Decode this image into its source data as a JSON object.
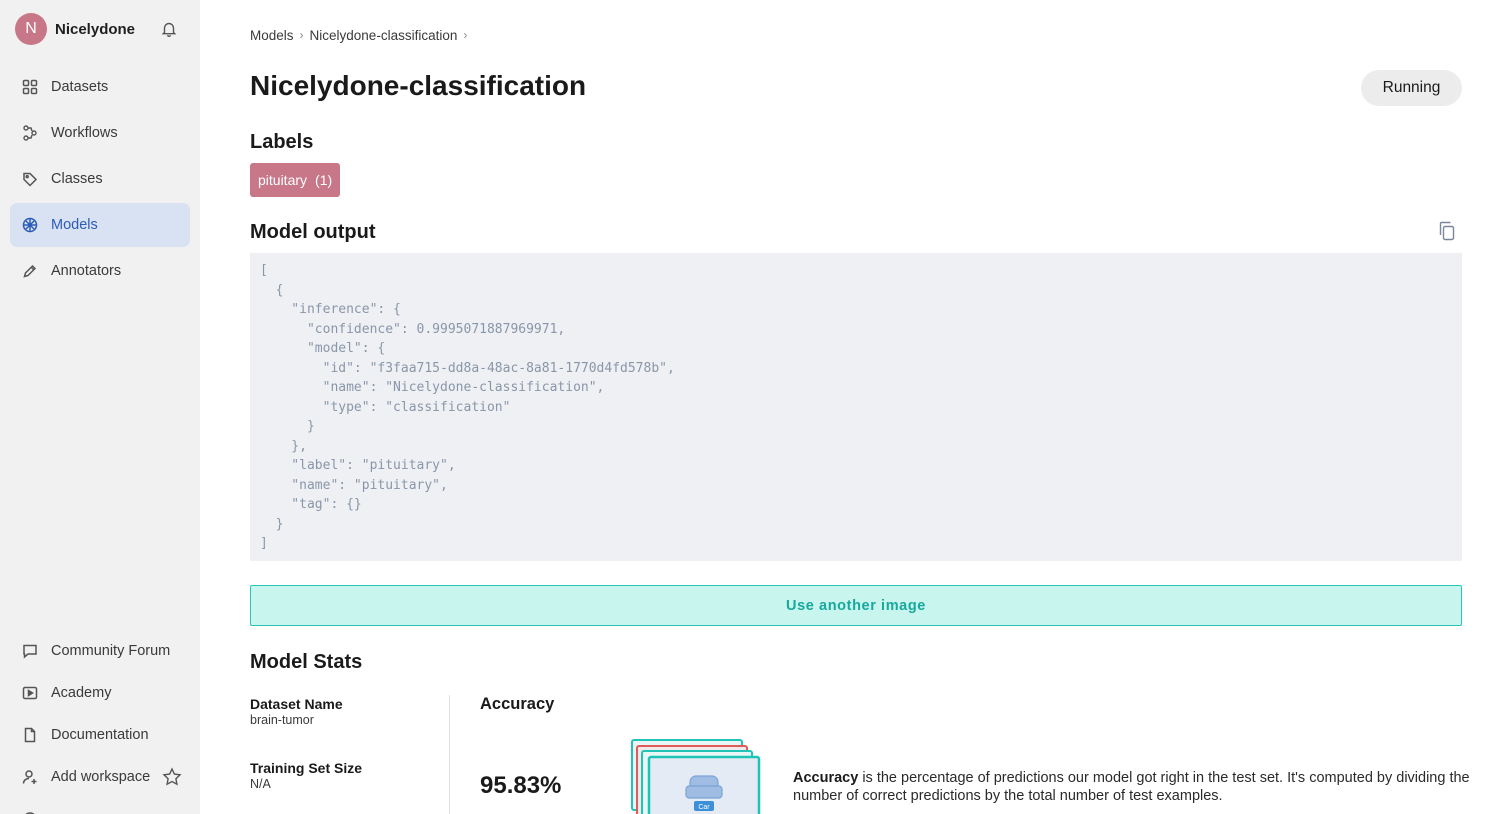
{
  "workspace": {
    "initial": "N",
    "name": "Nicelydone"
  },
  "sidebar": {
    "items": [
      {
        "label": "Datasets"
      },
      {
        "label": "Workflows"
      },
      {
        "label": "Classes"
      },
      {
        "label": "Models"
      },
      {
        "label": "Annotators"
      }
    ],
    "bottom": [
      {
        "label": "Community Forum"
      },
      {
        "label": "Academy"
      },
      {
        "label": "Documentation"
      },
      {
        "label": "Add workspace"
      }
    ]
  },
  "breadcrumb": {
    "root": "Models",
    "current": "Nicelydone-classification"
  },
  "page": {
    "title": "Nicelydone-classification",
    "status": "Running"
  },
  "labels": {
    "heading": "Labels",
    "chip": "pituitary",
    "count": "(1)"
  },
  "output": {
    "heading": "Model output",
    "code": "[\n  {\n    \"inference\": {\n      \"confidence\": 0.9995071887969971,\n      \"model\": {\n        \"id\": \"f3faa715-dd8a-48ac-8a81-1770d4fd578b\",\n        \"name\": \"Nicelydone-classification\",\n        \"type\": \"classification\"\n      }\n    },\n    \"label\": \"pituitary\",\n    \"name\": \"pituitary\",\n    \"tag\": {}\n  }\n]",
    "button": "Use another image"
  },
  "stats": {
    "heading": "Model Stats",
    "dataset_label": "Dataset Name",
    "dataset_value": "brain-tumor",
    "training_label": "Training Set Size",
    "training_value": "N/A",
    "accuracy_heading": "Accuracy",
    "accuracy_value": "95.83%",
    "illustration_label": "Car",
    "accuracy_term": "Accuracy",
    "accuracy_desc": " is the percentage of predictions our model got right in the test set. It's computed by dividing the number of correct predictions by the total number of test examples."
  },
  "colors": {
    "accent": "#2c5bb8",
    "chip": "#c77787",
    "teal": "#27c7b8"
  }
}
